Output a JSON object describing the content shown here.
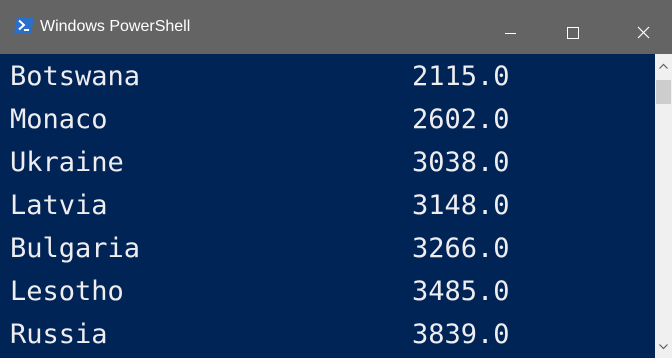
{
  "window": {
    "title": "Windows PowerShell",
    "controls": {
      "minimize": "minimize-icon",
      "maximize": "maximize-icon",
      "close": "close-icon"
    },
    "colors": {
      "titlebar": "#646464",
      "console_background": "#012456",
      "console_text": "#eeedf0"
    }
  },
  "console": {
    "rows": [
      {
        "country": "Botswana",
        "value": "2115.0"
      },
      {
        "country": "Monaco",
        "value": "2602.0"
      },
      {
        "country": "Ukraine",
        "value": "3038.0"
      },
      {
        "country": "Latvia",
        "value": "3148.0"
      },
      {
        "country": "Bulgaria",
        "value": "3266.0"
      },
      {
        "country": "Lesotho",
        "value": "3485.0"
      },
      {
        "country": "Russia",
        "value": "3839.0"
      }
    ]
  }
}
